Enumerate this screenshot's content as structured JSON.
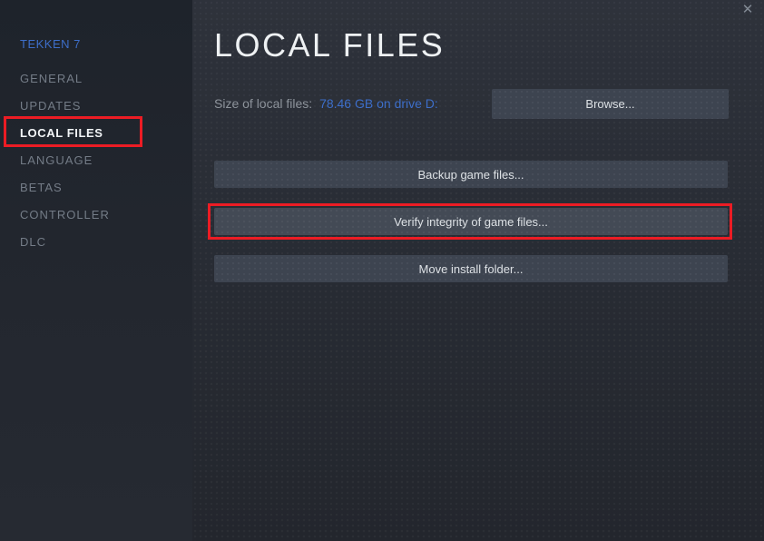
{
  "window": {
    "close_icon": "✕"
  },
  "sidebar": {
    "game_title": "TEKKEN 7",
    "items": [
      {
        "label": "GENERAL",
        "active": false
      },
      {
        "label": "UPDATES",
        "active": false
      },
      {
        "label": "LOCAL FILES",
        "active": true,
        "annotated": true
      },
      {
        "label": "LANGUAGE",
        "active": false
      },
      {
        "label": "BETAS",
        "active": false
      },
      {
        "label": "CONTROLLER",
        "active": false
      },
      {
        "label": "DLC",
        "active": false
      }
    ]
  },
  "main": {
    "title": "LOCAL FILES",
    "size_label": "Size of local files:",
    "size_value": "78.46 GB on drive D:",
    "browse_button": "Browse...",
    "action_buttons": [
      {
        "label": "Backup game files...",
        "annotated": false
      },
      {
        "label": "Verify integrity of game files...",
        "annotated": true
      },
      {
        "label": "Move install folder...",
        "annotated": false
      }
    ]
  },
  "colors": {
    "accent_blue": "#3d6ec9",
    "annotation_red": "#ec1c24",
    "button_bg": "#3d4450",
    "sidebar_bg": "#1e232b",
    "main_bg": "#2a2e36"
  }
}
